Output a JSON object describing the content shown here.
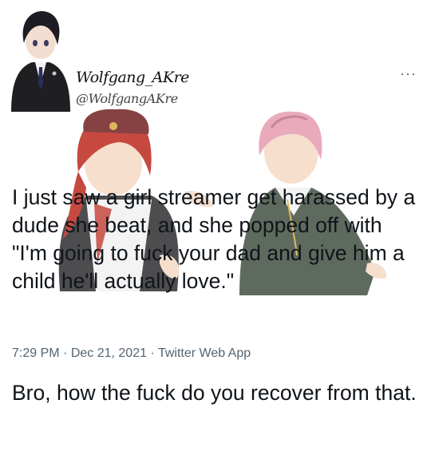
{
  "tweet": {
    "display_name": "Wolfgang_AKre",
    "handle": "@WolfgangAKre",
    "more_label": "···",
    "body_paragraphs": [
      "I just saw a girl streamer get harassed by a dude she beat, and she popped off with \"I'm going to fuck your dad and give him a child he'll actually love.\"",
      "Bro, how the fuck do you recover from that."
    ],
    "time": "7:29 PM",
    "date": "Dec 21, 2021",
    "source_app": "Twitter Web App",
    "separator": " · "
  },
  "colors": {
    "text": "#0f1419",
    "meta": "#536471",
    "girl_hair": "#c0362c",
    "boy_hair": "#e7a3b4"
  },
  "icons": [
    "avatar-image",
    "more-options-icon"
  ]
}
